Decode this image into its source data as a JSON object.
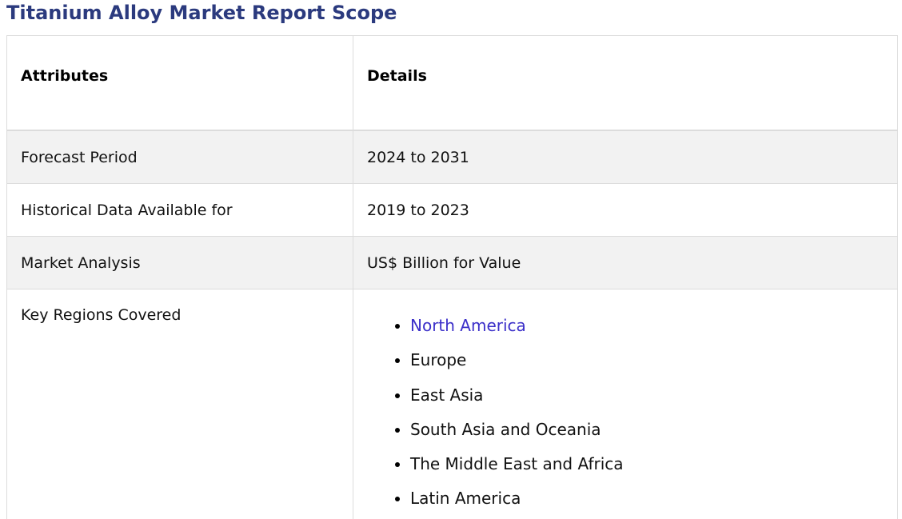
{
  "title": "Titanium Alloy Market Report Scope",
  "table": {
    "headers": [
      "Attributes",
      "Details"
    ],
    "rows": [
      {
        "attribute": "Forecast Period",
        "detail": "2024 to 2031"
      },
      {
        "attribute": "Historical Data Available for",
        "detail": "2019 to 2023"
      },
      {
        "attribute": "Market Analysis",
        "detail": "US$ Billion for Value"
      },
      {
        "attribute": "Key Regions Covered"
      }
    ],
    "regions": [
      "North America",
      "Europe",
      "East Asia",
      "South Asia and Oceania",
      "The Middle East and Africa",
      "Latin America"
    ]
  },
  "colors": {
    "title": "#2b3a7e",
    "link": "#3b2fc9",
    "shaded_row": "#f2f2f2",
    "border": "#dcdcdc"
  }
}
